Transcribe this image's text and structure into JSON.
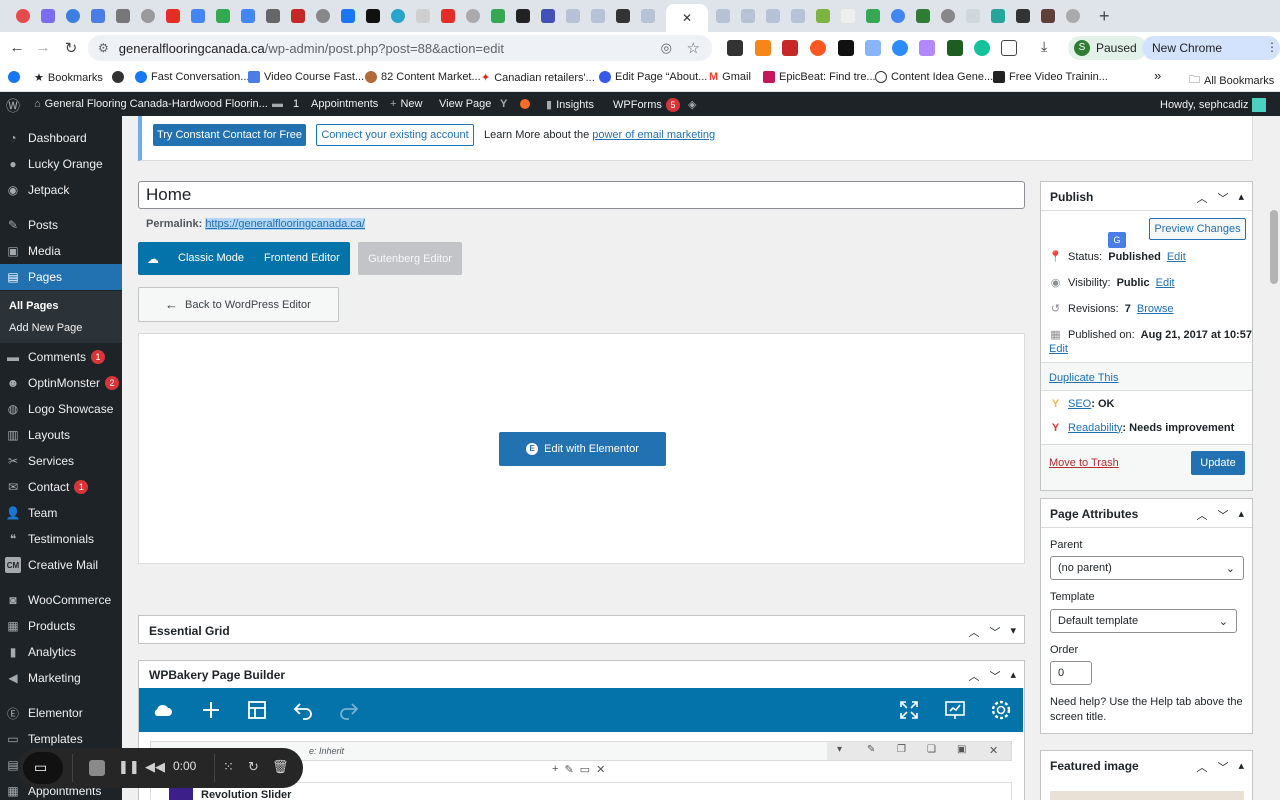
{
  "browser": {
    "url_host": "generalflooringcanada.ca",
    "url_path": "/wp-admin/post.php?post=88&action=edit",
    "profile_status": "Paused",
    "profile_initial": "S",
    "update_button": "New Chrome available"
  },
  "bookmarks": {
    "items": [
      "Bookmarks",
      "Fast Conversation...",
      "Video Course Fast...",
      "82 Content Market...",
      "Canadian retailers'...",
      "Edit Page “About...",
      "Gmail",
      "EpicBeat: Find tre...",
      "Content Idea Gene...",
      "Free Video Trainin..."
    ],
    "more": "»",
    "all_bookmarks": "All Bookmarks"
  },
  "adminbar": {
    "site_name": "General Flooring Canada-Hardwood Floorin...",
    "comments_count": "1",
    "appointments": "Appointments",
    "new": "New",
    "view_page": "View Page",
    "insights": "Insights",
    "wpforms": "WPForms",
    "wpforms_count": "5",
    "howdy": "Howdy, sephcadiz"
  },
  "sidebar": {
    "items": [
      {
        "label": "Dashboard",
        "icon": "dashboard-icon"
      },
      {
        "label": "Lucky Orange",
        "icon": "orange-icon"
      },
      {
        "label": "Jetpack",
        "icon": "jetpack-icon"
      },
      {
        "label": "Posts",
        "icon": "pin-icon"
      },
      {
        "label": "Media",
        "icon": "media-icon"
      },
      {
        "label": "Pages",
        "icon": "pages-icon"
      },
      {
        "label": "Comments",
        "icon": "comment-icon",
        "badge": "1"
      },
      {
        "label": "OptinMonster",
        "icon": "optinmonster-icon",
        "badge": "2"
      },
      {
        "label": "Logo Showcase",
        "icon": "logo-icon"
      },
      {
        "label": "Layouts",
        "icon": "layouts-icon"
      },
      {
        "label": "Services",
        "icon": "wrench-icon"
      },
      {
        "label": "Contact",
        "icon": "mail-icon",
        "badge": "1"
      },
      {
        "label": "Team",
        "icon": "person-icon"
      },
      {
        "label": "Testimonials",
        "icon": "quote-icon"
      },
      {
        "label": "Creative Mail",
        "icon": "cm-icon"
      },
      {
        "label": "WooCommerce",
        "icon": "woo-icon"
      },
      {
        "label": "Products",
        "icon": "products-icon"
      },
      {
        "label": "Analytics",
        "icon": "analytics-icon"
      },
      {
        "label": "Marketing",
        "icon": "megaphone-icon"
      },
      {
        "label": "Elementor",
        "icon": "elementor-icon"
      },
      {
        "label": "Templates",
        "icon": "templates-icon"
      },
      {
        "label": "rm",
        "icon": "form-icon"
      },
      {
        "label": "Appointments",
        "icon": "calendar-icon"
      }
    ],
    "submenu": [
      "All Pages",
      "Add New Page"
    ]
  },
  "notice": {
    "try_button": "Try Constant Contact for Free",
    "connect_button": "Connect your existing account",
    "learn_text": "Learn More about the",
    "learn_link": "power of email marketing"
  },
  "editor": {
    "title": "Home",
    "permalink_label": "Permalink:",
    "permalink_url": "https://generalflooringcanada.ca/",
    "classic_mode": "Classic Mode",
    "frontend_editor": "Frontend Editor",
    "gutenberg_editor": "Gutenberg Editor",
    "back_button": "Back to WordPress Editor",
    "elementor_button": "Edit with Elementor",
    "essential_grid": "Essential Grid",
    "wpbakery": "WPBakery Page Builder",
    "row_text": "e: Inherit",
    "revolution_slider": "Revolution Slider"
  },
  "publish": {
    "title": "Publish",
    "preview_button": "Preview Changes",
    "status_label": "Status:",
    "status_value": "Published",
    "visibility_label": "Visibility:",
    "visibility_value": "Public",
    "revisions_label": "Revisions:",
    "revisions_value": "7",
    "browse": "Browse",
    "published_label": "Published on:",
    "published_value": "Aug 21, 2017 at 10:57",
    "edit": "Edit",
    "duplicate": "Duplicate This",
    "seo_label": "SEO",
    "seo_value": ": OK",
    "readability_label": "Readability",
    "readability_value": ": Needs improvement",
    "trash": "Move to Trash",
    "update": "Update"
  },
  "attributes": {
    "title": "Page Attributes",
    "parent_label": "Parent",
    "parent_value": "(no parent)",
    "template_label": "Template",
    "template_value": "Default template",
    "order_label": "Order",
    "order_value": "0",
    "help": "Need help? Use the Help tab above the screen title."
  },
  "featured": {
    "title": "Featured image"
  },
  "recorder": {
    "time": "0:00"
  },
  "colors": {
    "wp_dark": "#1d2327",
    "wp_blue": "#2271b1",
    "wpbakery_blue": "#0473aa",
    "badge_red": "#d63638"
  }
}
